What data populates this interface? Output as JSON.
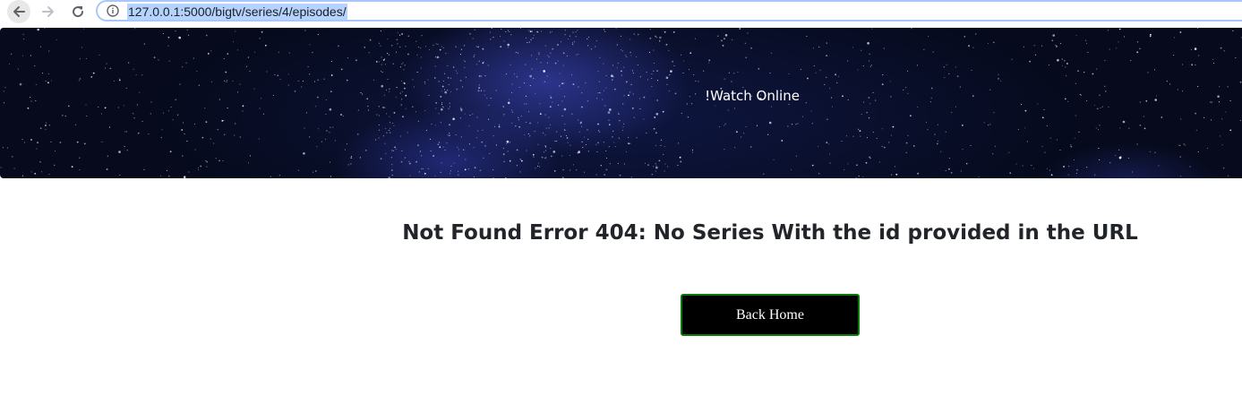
{
  "browser": {
    "url": "127.0.0.1:5000/bigtv/series/4/episodes/",
    "back_icon": "arrow-left-icon",
    "forward_icon": "arrow-right-icon",
    "reload_icon": "reload-icon",
    "info_icon": "info-circle-icon",
    "url_highlight_color": "#b5d3ff"
  },
  "hero": {
    "title": "!Watch Online",
    "background": "starry-night-sky"
  },
  "main": {
    "error_heading": "Not Found Error 404: No Series With the id provided in the URL",
    "back_home_label": "Back Home",
    "button_border_color": "#0a7a0a"
  }
}
